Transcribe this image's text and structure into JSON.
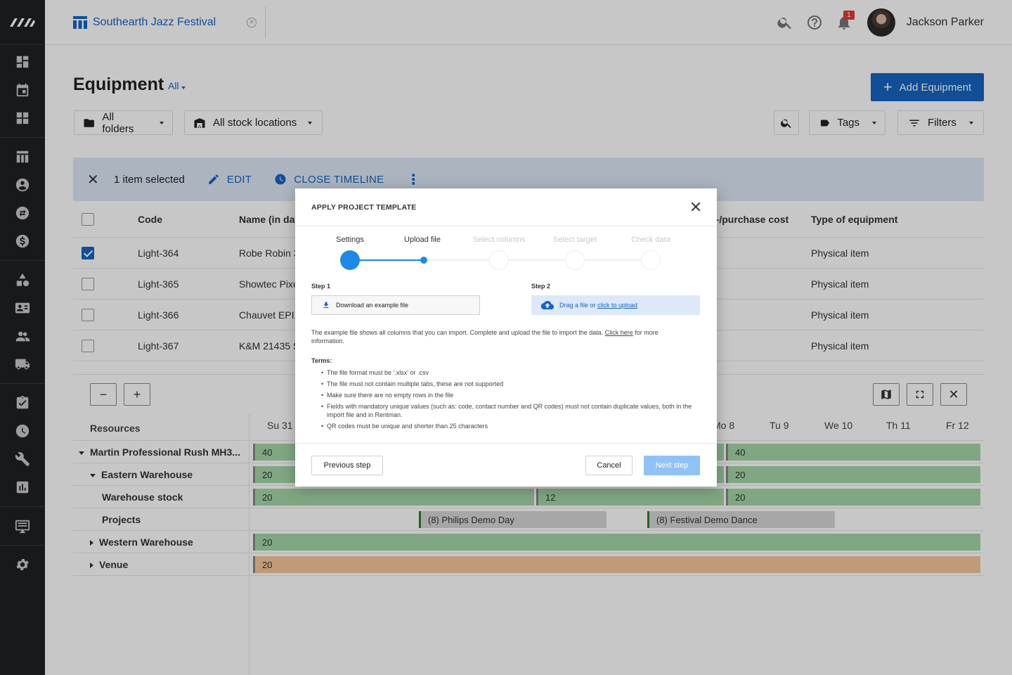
{
  "topbar": {
    "project_name": "Southearth Jazz Festival",
    "notifications_count": "1",
    "user_name": "Jackson Parker"
  },
  "page": {
    "title": "Equipment",
    "view_filter": "All",
    "add_button": "Add Equipment",
    "folders_filter": "All folders",
    "stock_filter": "All stock locations",
    "tags_filter": "Tags",
    "filters_button": "Filters"
  },
  "selection": {
    "count_label": "1 item selected",
    "edit_label": "EDIT",
    "timeline_label": "CLOSE TIMELINE"
  },
  "table": {
    "headers": {
      "code": "Code",
      "name": "Name (in data",
      "cost": "t-/purchase cost",
      "type": "Type of equipment"
    },
    "rows": [
      {
        "code": "Light-364",
        "name": "Robe Robin 3",
        "type": "Physical item",
        "checked": true
      },
      {
        "code": "Light-365",
        "name": "Showtec Pixel",
        "type": "Physical item",
        "checked": false
      },
      {
        "code": "Light-366",
        "name": "Chauvet EPIX",
        "type": "Physical item",
        "checked": false
      },
      {
        "code": "Light-367",
        "name": "K&M 21435 Sp",
        "type": "Physical item",
        "checked": false
      }
    ]
  },
  "timeline": {
    "resources_label": "Resources",
    "days": [
      "Su 31",
      "Mo 8",
      "Tu 9",
      "We 10",
      "Th 11",
      "Fr 12"
    ],
    "rows": [
      {
        "label": "Martin Professional Rush MH3...",
        "bars": [
          "40",
          "40"
        ]
      },
      {
        "label": "Eastern Warehouse",
        "bars": [
          "20",
          "20"
        ]
      },
      {
        "label": "Warehouse stock",
        "bars": [
          "20",
          "12",
          "20"
        ]
      },
      {
        "label": "Projects",
        "bars": [
          "(8) Philips Demo Day",
          "(8) Festival Demo Dance"
        ]
      },
      {
        "label": "Western Warehouse",
        "bars": [
          "20"
        ]
      },
      {
        "label": "Venue",
        "bars": [
          "20"
        ]
      }
    ]
  },
  "modal": {
    "title": "APPLY PROJECT TEMPLATE",
    "steps": [
      "Settings",
      "Upload file",
      "Select columns",
      "Select target",
      "Check data"
    ],
    "step1_label": "Step 1",
    "step2_label": "Step 2",
    "download_label": "Download an example file",
    "upload_prefix": "Drag a file or ",
    "upload_link": "click to upload",
    "info_text": "The example file shows all columns that you can import. Complete and upload the file to import the data. ",
    "info_link": "Click here",
    "info_suffix": " for more information.",
    "terms_heading": "Terms:",
    "terms": [
      "The file format must be '.xlsx' or .csv",
      "The file must not contain multiple tabs, these are not supported",
      "Make sure there are no empty rows in the file",
      "Fields with mandatory unique values (such as: code, contact number and QR codes) must not contain duplicate values, both in the import file and in Rentman.",
      "QR codes must be unique and shorter than 25 characters"
    ],
    "previous_button": "Previous step",
    "cancel_button": "Cancel",
    "next_button": "Next step"
  },
  "colors": {
    "accent": "#1565c0",
    "sidebar": "#1f2023",
    "bar_green": "#a5d6a7",
    "bar_orange": "#f5c79a",
    "next_disabled": "#90c2f5"
  }
}
